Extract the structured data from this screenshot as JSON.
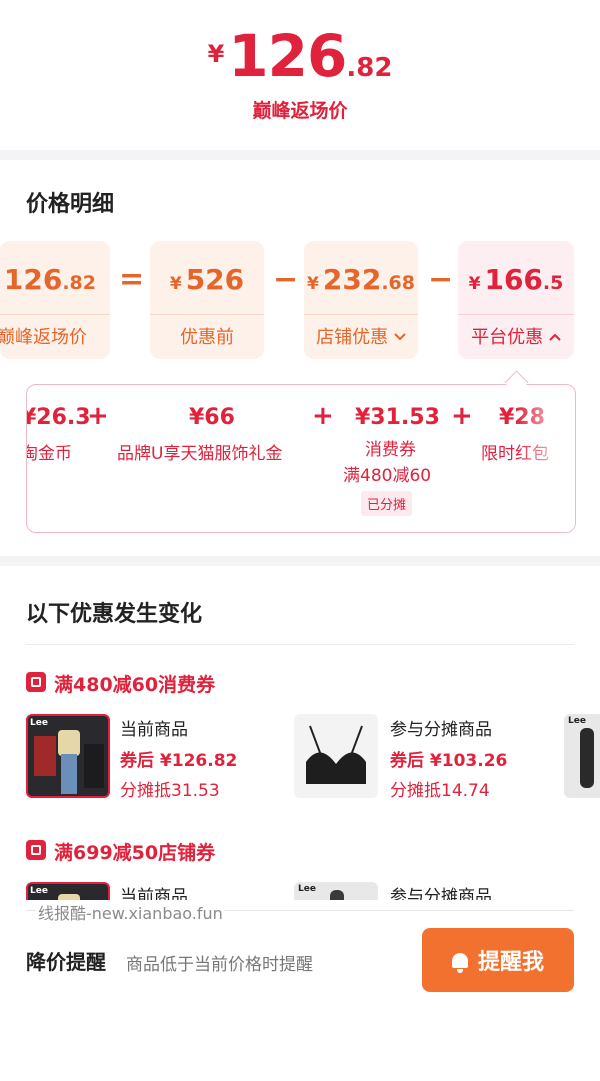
{
  "hero": {
    "currency": "¥",
    "price_int": "126",
    "price_dec": ".82",
    "label": "巅峰返场价"
  },
  "breakdown": {
    "title": "价格明细",
    "cards": [
      {
        "currency": "¥",
        "int": "126",
        "dec": ".82",
        "label": "巅峰返场价"
      },
      {
        "currency": "¥",
        "int": "526",
        "dec": "",
        "label": "优惠前"
      },
      {
        "currency": "¥",
        "int": "232",
        "dec": ".68",
        "label": "店铺优惠"
      },
      {
        "currency": "¥",
        "int": "166",
        "dec": ".5",
        "label": "平台优惠"
      }
    ],
    "ops": [
      "=",
      "−",
      "−"
    ],
    "card3_chevron": "chevron-down-icon",
    "card4_chevron": "chevron-up-icon"
  },
  "platform_details": {
    "items": [
      {
        "amount": "¥26.3",
        "name": "淘金币"
      },
      {
        "amount": "¥66",
        "name": "品牌U享天猫服饰礼金"
      },
      {
        "amount": "¥31.53",
        "name": "消费券",
        "sub": "满480减60",
        "tag": "已分摊"
      },
      {
        "amount": "¥28",
        "name": "限时红包"
      }
    ],
    "plus": "+"
  },
  "changes": {
    "title": "以下优惠发生变化",
    "coupons": [
      {
        "title": "满480减60消费券",
        "current": {
          "label": "当前商品",
          "price": "券后 ¥126.82",
          "share": "分摊抵31.53"
        },
        "other": {
          "label": "参与分摊商品",
          "price": "券后 ¥103.26",
          "share": "分摊抵14.74"
        }
      },
      {
        "title": "满699减50店铺券",
        "current": {
          "label": "当前商品"
        },
        "other": {
          "label": "参与分摊商品"
        }
      }
    ],
    "brand_text": "Lee"
  },
  "watermark": "线报酷-new.xianbao.fun",
  "remind": {
    "title": "降价提醒",
    "subtitle": "商品低于当前价格时提醒",
    "button": "提醒我"
  },
  "colors": {
    "accent_red": "#e0223c",
    "accent_orange": "#f2712e",
    "card_orange": "#e5662a"
  }
}
